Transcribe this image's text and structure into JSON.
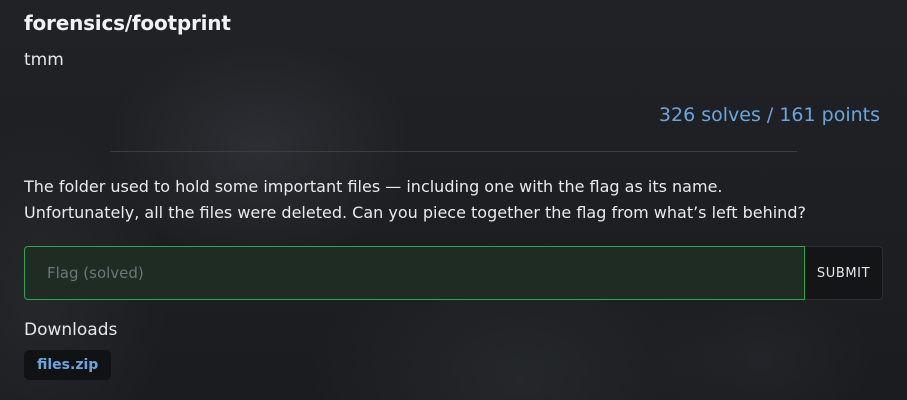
{
  "challenge": {
    "title": "forensics/footprint",
    "author": "tmm",
    "stats": "326 solves / 161 points",
    "description_lines": [
      "The folder used to hold some important files — including one with the flag as its name.",
      "Unfortunately, all the files were deleted. Can you piece together the flag from what’s left behind?"
    ]
  },
  "flag_form": {
    "placeholder": "Flag (solved)",
    "value": "",
    "submit_label": "SUBMIT"
  },
  "downloads": {
    "heading": "Downloads",
    "files": [
      {
        "name": "files.zip"
      }
    ]
  },
  "colors": {
    "accent_blue": "#6aa6de",
    "solved_green": "#2fa552",
    "background": "#1b1d20"
  }
}
